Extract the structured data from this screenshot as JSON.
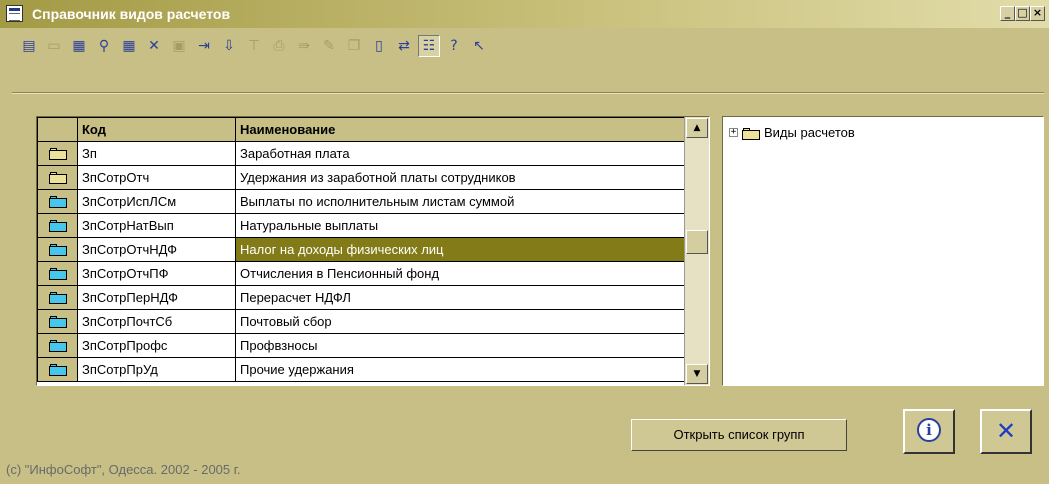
{
  "titlebar": {
    "title": "Справочник видов расчетов",
    "min": "_",
    "max": "□",
    "close": "×"
  },
  "toolbar": {
    "buttons": [
      {
        "name": "toolbar-new-icon",
        "glyph": "▤",
        "state": "on"
      },
      {
        "name": "toolbar-folder-icon",
        "glyph": "▭",
        "state": "dis"
      },
      {
        "name": "toolbar-edit-icon",
        "glyph": "▦",
        "state": "on"
      },
      {
        "name": "toolbar-find-icon",
        "glyph": "⚲",
        "state": "on"
      },
      {
        "name": "toolbar-table-icon",
        "glyph": "▦",
        "state": "on"
      },
      {
        "name": "toolbar-delete-icon",
        "glyph": "✕",
        "state": "on"
      },
      {
        "name": "toolbar-copy-icon",
        "glyph": "▣",
        "state": "dis"
      },
      {
        "name": "toolbar-move-icon",
        "glyph": "⇥",
        "state": "on"
      },
      {
        "name": "toolbar-move-down-icon",
        "glyph": "⇩",
        "state": "on"
      },
      {
        "name": "toolbar-filter-icon",
        "glyph": "⊤",
        "state": "dis"
      },
      {
        "name": "toolbar-print-icon",
        "glyph": "⎙",
        "state": "dis"
      },
      {
        "name": "toolbar-export-icon",
        "glyph": "⇛",
        "state": "dis"
      },
      {
        "name": "toolbar-wand-icon",
        "glyph": "✎",
        "state": "dis"
      },
      {
        "name": "toolbar-clone-icon",
        "glyph": "❐",
        "state": "dis"
      },
      {
        "name": "toolbar-doc-icon",
        "glyph": "▯",
        "state": "on"
      },
      {
        "name": "toolbar-transfer-icon",
        "glyph": "⇄",
        "state": "on"
      },
      {
        "name": "toolbar-tree-icon",
        "glyph": "☷",
        "state": "act"
      },
      {
        "name": "toolbar-help-icon",
        "glyph": "?",
        "state": "on"
      },
      {
        "name": "toolbar-whatsthis-icon",
        "glyph": "↖",
        "state": "on"
      }
    ]
  },
  "table": {
    "columns": [
      "Код",
      "Наименование"
    ],
    "rows": [
      {
        "code": "Зп",
        "name": "Заработная плата",
        "kind": "group",
        "selected": false
      },
      {
        "code": "ЗпСотрОтч",
        "name": "Удержания из заработной платы сотрудников",
        "kind": "group",
        "selected": false
      },
      {
        "code": "ЗпСотрИспЛСм",
        "name": "Выплаты по исполнительным листам суммой",
        "kind": "item",
        "selected": false
      },
      {
        "code": "ЗпСотрНатВып",
        "name": "Натуральные выплаты",
        "kind": "item",
        "selected": false
      },
      {
        "code": "ЗпСотрОтчНДФ",
        "name": "Налог на доходы физических лиц",
        "kind": "item",
        "selected": true
      },
      {
        "code": "ЗпСотрОтчПФ",
        "name": "Отчисления в Пенсионный фонд",
        "kind": "item",
        "selected": false
      },
      {
        "code": "ЗпСотрПерНДФ",
        "name": "Перерасчет НДФЛ",
        "kind": "item",
        "selected": false
      },
      {
        "code": "ЗпСотрПочтСб",
        "name": "Почтовый сбор",
        "kind": "item",
        "selected": false
      },
      {
        "code": "ЗпСотрПрофс",
        "name": "Профвзносы",
        "kind": "item",
        "selected": false
      },
      {
        "code": "ЗпСотрПрУд",
        "name": "Прочие удержания",
        "kind": "item",
        "selected": false
      }
    ]
  },
  "tree": {
    "expander": "+",
    "root_label": "Виды расчетов"
  },
  "footer": {
    "open_groups_label": "Открыть список групп",
    "info_glyph": "i",
    "close_glyph": "✕",
    "copyright": "(с) \"ИнфоСофт\", Одесса. 2002 - 2005 г."
  },
  "colors": {
    "background": "#c7bf86",
    "selection": "#837b18",
    "group_folder": "#ece29a",
    "item_folder": "#45c6ea"
  }
}
